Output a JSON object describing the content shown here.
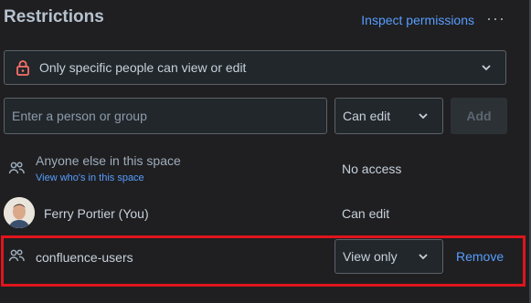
{
  "header": {
    "title": "Restrictions",
    "inspect_link": "Inspect permissions",
    "more_label": "···"
  },
  "restriction_mode": {
    "icon": "lock-icon",
    "label": "Only specific people can view or edit"
  },
  "add_form": {
    "placeholder": "Enter a person or group",
    "permission": "Can edit",
    "add_label": "Add"
  },
  "entries": [
    {
      "icon": "group-icon",
      "name": "Anyone else in this space",
      "link": "View who's in this space",
      "permission": "No access"
    },
    {
      "icon": "avatar",
      "name": "Ferry Portier (You)",
      "permission": "Can edit"
    },
    {
      "icon": "group-icon",
      "name": "confluence-users",
      "permission": "View only",
      "remove_label": "Remove",
      "highlighted": true
    }
  ],
  "colors": {
    "background": "#1f1f21",
    "link": "#579dff",
    "highlight": "#e0151c",
    "lock": "#f87168"
  }
}
